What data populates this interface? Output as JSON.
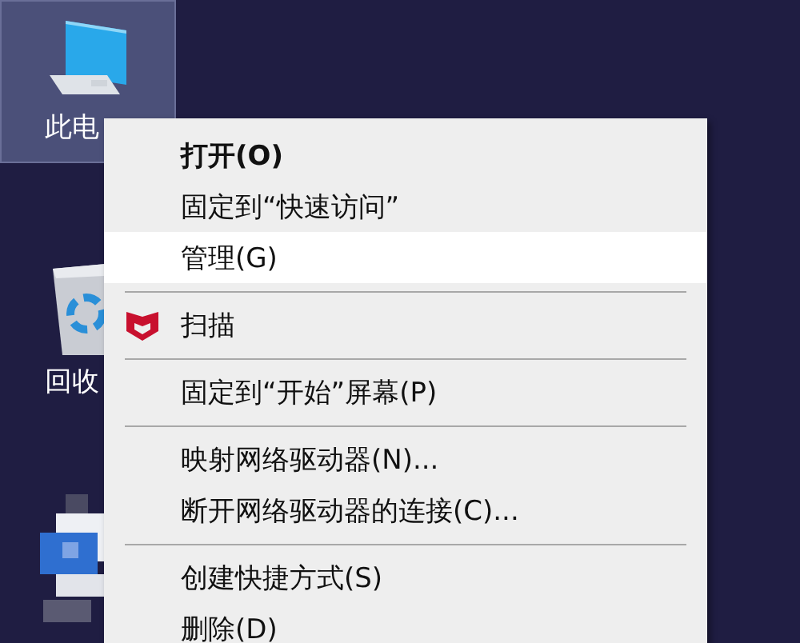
{
  "desktop_icons": [
    {
      "kind": "computer",
      "label": "此电",
      "selected": true
    },
    {
      "kind": "recycle_bin",
      "label": "回收",
      "selected": false
    },
    {
      "kind": "blurred",
      "selected": false
    }
  ],
  "context_menu": {
    "items": [
      {
        "kind": "item",
        "label": "打开(O)",
        "default": true,
        "highlighted": false
      },
      {
        "kind": "item",
        "label": "固定到“快速访问”",
        "default": false,
        "highlighted": false
      },
      {
        "kind": "item",
        "label": "管理(G)",
        "default": false,
        "highlighted": true
      },
      {
        "kind": "separator"
      },
      {
        "kind": "icon_item",
        "label": "扫描",
        "default": false,
        "highlighted": false
      },
      {
        "kind": "separator"
      },
      {
        "kind": "item",
        "label": "固定到“开始”屏幕(P)",
        "default": false,
        "highlighted": false
      },
      {
        "kind": "separator"
      },
      {
        "kind": "item",
        "label": "映射网络驱动器(N)...",
        "default": false,
        "highlighted": false
      },
      {
        "kind": "item",
        "label": "断开网络驱动器的连接(C)...",
        "default": false,
        "highlighted": false
      },
      {
        "kind": "separator"
      },
      {
        "kind": "item",
        "label": "创建快捷方式(S)",
        "default": false,
        "highlighted": false
      },
      {
        "kind": "item",
        "label": "删除(D)",
        "default": false,
        "highlighted": false
      }
    ]
  }
}
